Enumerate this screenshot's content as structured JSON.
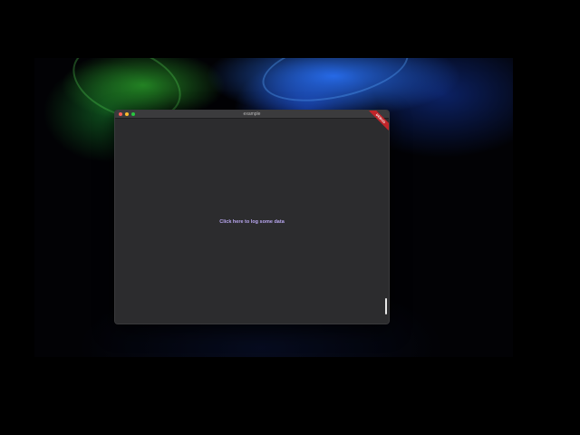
{
  "window": {
    "title": "example",
    "ribbon_label": "DEBUG"
  },
  "content": {
    "log_link_label": "Click here to log some data"
  },
  "colors": {
    "close_button": "#fe5f57",
    "minimize_button": "#febc2e",
    "maximize_button": "#28c840",
    "link_text": "#b9a7f0",
    "ribbon": "#c0252a",
    "window_background": "#2c2c2e"
  },
  "icons": {
    "close": "close-icon",
    "minimize": "minimize-icon",
    "maximize": "maximize-icon"
  }
}
